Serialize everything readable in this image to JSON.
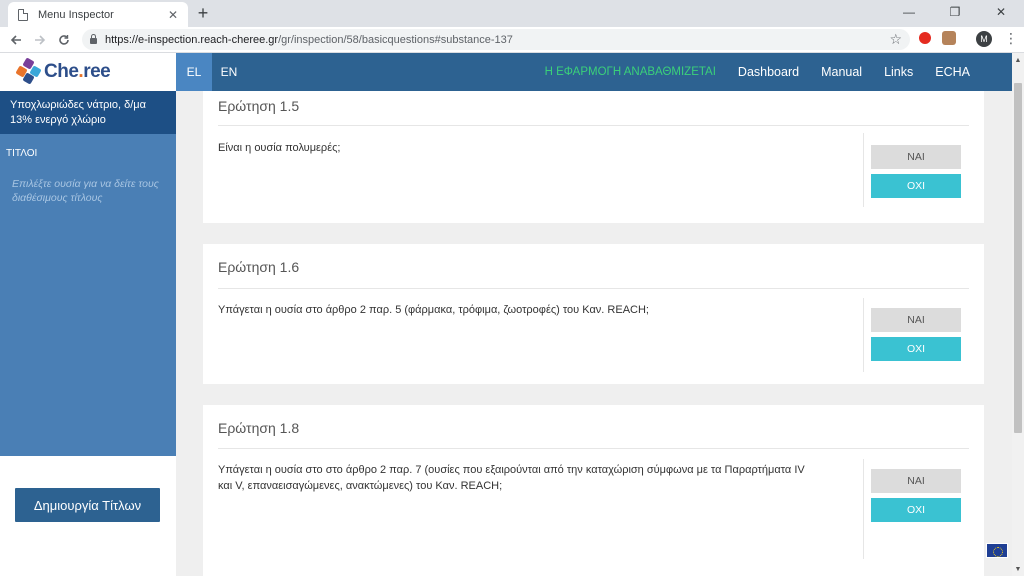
{
  "browser": {
    "tab_title": "Menu Inspector",
    "tab_close": "✕",
    "new_tab": "+",
    "url_prefix": "https://",
    "url_host": "e-inspection.reach-cheree.gr",
    "url_path": "/gr/inspection/58/basicquestions#substance-137",
    "avatar_initial": "M",
    "window_controls": {
      "minimize": "—",
      "restore": "❐",
      "close": "✕"
    }
  },
  "app": {
    "logo_text_main": "Che",
    "logo_text_dot": ".",
    "logo_text_end": "ree",
    "logo_colors": [
      "#2d4e8a",
      "#e9742b",
      "#7a3f9a",
      "#3aa7d8"
    ],
    "languages": [
      {
        "code": "EL",
        "active": true
      },
      {
        "code": "EN",
        "active": false
      }
    ],
    "header": {
      "notice": "Η ΕΦΑΡΜΟΓΗ ΑΝΑΒΑΘΜΙΖΕΤΑΙ",
      "links": [
        "Dashboard",
        "Manual",
        "Links",
        "ECHA"
      ]
    },
    "colors": {
      "header": "#2d6291",
      "accent_no": "#3ac2d2",
      "notice": "#3bd07a"
    }
  },
  "sidebar": {
    "substance": "Υποχλωριώδες νάτριο, δ/μα 13% ενεργό χλώριο",
    "section_title": "ΤΙΤΛΟΙ",
    "hint": "Επιλέξτε ουσία για να δείτε τους διαθέσιμους τίτλους",
    "create_button": "Δημιουργία Τίτλων"
  },
  "questions": [
    {
      "title": "Ερώτηση 1.5",
      "text": "Είναι η ουσία πολυμερές;",
      "yes": "ΝΑΙ",
      "no": "ΟΧΙ"
    },
    {
      "title": "Ερώτηση 1.6",
      "text": "Υπάγεται η ουσία στο άρθρο 2 παρ. 5 (φάρμακα, τρόφιμα, ζωοτροφές) του Καν. REACH;",
      "yes": "ΝΑΙ",
      "no": "ΟΧΙ"
    },
    {
      "title": "Ερώτηση 1.8",
      "text": "Υπάγεται η ουσία στο στο άρθρο 2 παρ. 7 (ουσίες που εξαιρούνται από την καταχώριση σύμφωνα με τα Παραρτήματα IV και V, επαναεισαγώμενες, ανακτώμενες) του Καν. REACH;",
      "yes": "ΝΑΙ",
      "no": "ΟΧΙ"
    }
  ]
}
